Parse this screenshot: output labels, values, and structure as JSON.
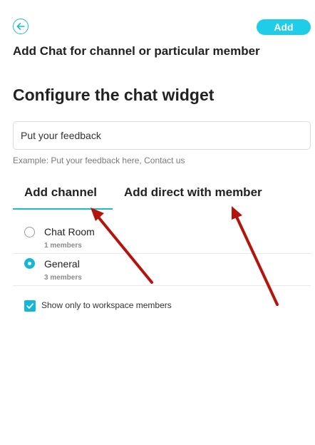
{
  "header": {
    "back_icon": "arrow-left-circle-icon",
    "add_label": "Add",
    "accent_color": "#1fcde9"
  },
  "subtitle": "Add Chat for channel or particular member",
  "heading": "Configure the chat widget",
  "feedback": {
    "value": "Put your feedback",
    "hint": "Example: Put your feedback here, Contact us"
  },
  "tabs": [
    {
      "label": "Add channel",
      "active": true
    },
    {
      "label": "Add direct with member",
      "active": false
    }
  ],
  "channels": [
    {
      "name": "Chat Room",
      "members": "1 members",
      "selected": false
    },
    {
      "name": "General",
      "members": "3 members",
      "selected": true
    }
  ],
  "workspace_checkbox": {
    "label": "Show only to workspace members",
    "checked": true
  },
  "annotation_color": "#b3140c"
}
